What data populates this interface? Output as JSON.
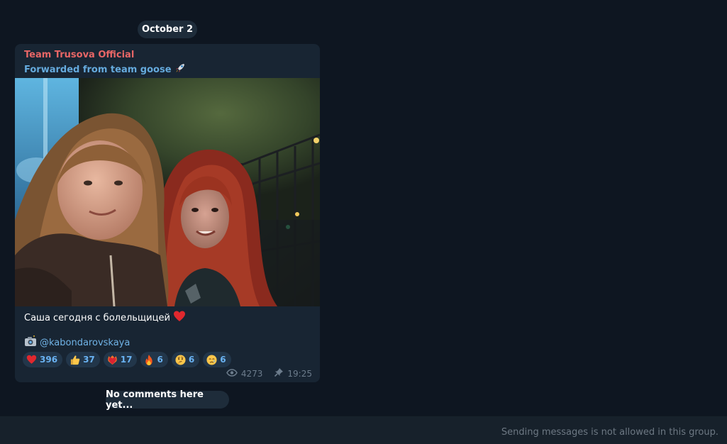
{
  "date_separator": "October 2",
  "message": {
    "sender": "Team Trusova Official",
    "forwarded_from": "Forwarded from team goose",
    "caption": "Саша сегодня с болельщицей",
    "credit_handle": "@kabondarovskaya",
    "reactions": [
      {
        "icon": "heart-icon",
        "count": "396"
      },
      {
        "icon": "thumbs-up-icon",
        "count": "37"
      },
      {
        "icon": "heart-on-fire-icon",
        "count": "17"
      },
      {
        "icon": "fire-icon",
        "count": "6"
      },
      {
        "icon": "thinking-face-icon",
        "count": "6"
      },
      {
        "icon": "crying-face-icon",
        "count": "6"
      }
    ],
    "views": "4273",
    "time": "19:25"
  },
  "comments_placeholder": "No comments here yet...",
  "footer_notice": "Sending messages is not allowed in this group.",
  "colors": {
    "background": "#0e1621",
    "bubble": "#182533",
    "sender_name": "#e86666",
    "link": "#6ab3f3",
    "reaction_bg": "#22364a"
  }
}
